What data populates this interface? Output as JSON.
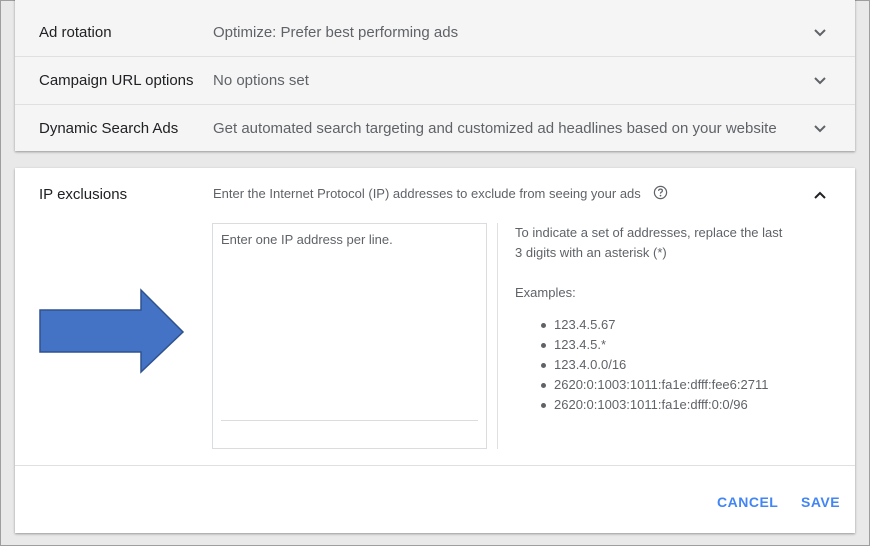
{
  "settings_rows": [
    {
      "label": "Ad rotation",
      "value": "Optimize: Prefer best performing ads"
    },
    {
      "label": "Campaign URL options",
      "value": "No options set"
    },
    {
      "label": "Dynamic Search Ads",
      "value": "Get automated search targeting and customized ad headlines based on your website"
    }
  ],
  "ip_exclusions": {
    "title": "IP exclusions",
    "description": "Enter the Internet Protocol (IP) addresses to exclude from seeing your ads",
    "input_placeholder": "Enter one IP address per line.",
    "input_value": "",
    "help_line1": "To indicate a set of addresses, replace the last 3 digits with an asterisk (*)",
    "examples_title": "Examples:",
    "examples": [
      "123.4.5.67",
      "123.4.5.*",
      "123.4.0.0/16",
      "2620:0:1003:1011:fa1e:dfff:fee6:2711",
      "2620:0:1003:1011:fa1e:dfff:0:0/96"
    ]
  },
  "actions": {
    "cancel_label": "CANCEL",
    "save_label": "SAVE"
  },
  "colors": {
    "accent": "#4285f4",
    "arrow_fill": "#4472c4",
    "arrow_stroke": "#2f528f"
  },
  "icons": {
    "row_expand": "chevron-down-icon",
    "section_collapse": "chevron-up-icon",
    "help": "help-circle-icon",
    "pointer": "arrow-right-icon"
  }
}
